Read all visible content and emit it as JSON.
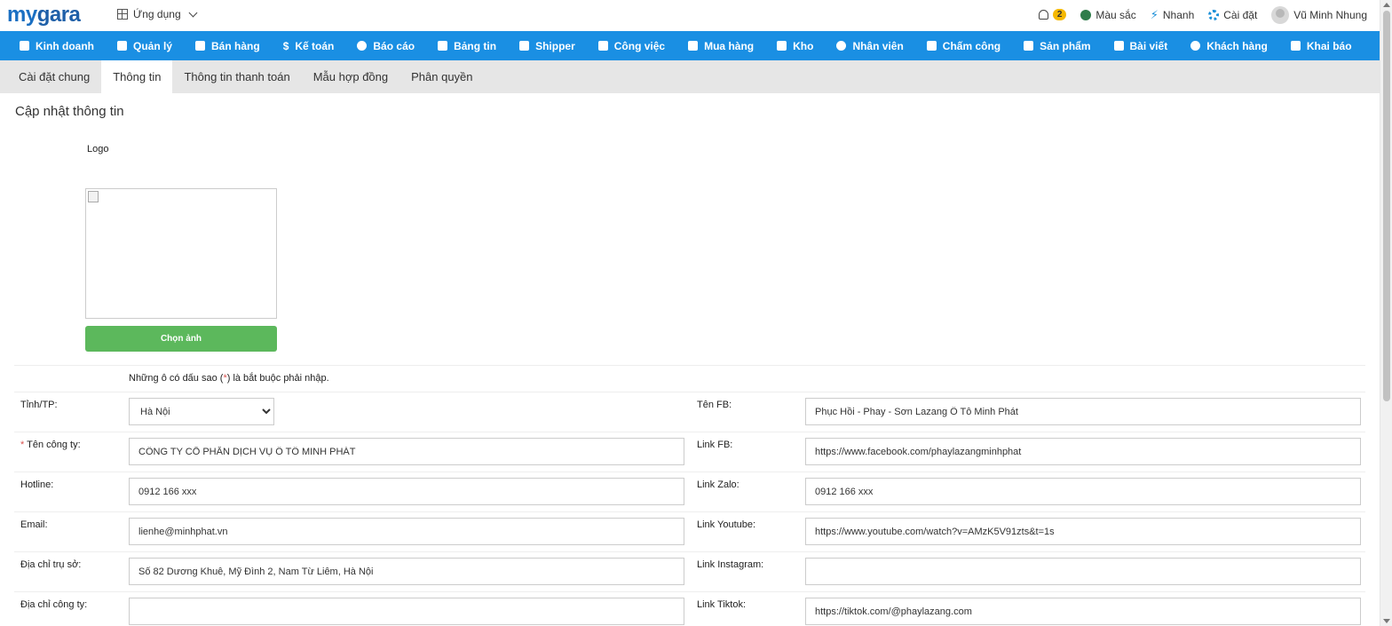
{
  "header": {
    "logo_part1": "my",
    "logo_part2": "gara",
    "apps_label": "Ứng dụng",
    "notification_count": "2",
    "color_label": "Màu sắc",
    "quick_label": "Nhanh",
    "settings_label": "Cài đặt",
    "user_name": "Vũ Minh Nhung"
  },
  "nav": {
    "items": [
      {
        "label": "Kinh doanh",
        "icon": "bag-icon"
      },
      {
        "label": "Quản lý",
        "icon": "id-card-icon"
      },
      {
        "label": "Bán hàng",
        "icon": "cart-icon"
      },
      {
        "label": "Kế toán",
        "icon": "dollar-icon"
      },
      {
        "label": "Báo cáo",
        "icon": "pie-chart-icon"
      },
      {
        "label": "Bảng tin",
        "icon": "home-icon"
      },
      {
        "label": "Shipper",
        "icon": "truck-icon"
      },
      {
        "label": "Công việc",
        "icon": "calendar-icon"
      },
      {
        "label": "Mua hàng",
        "icon": "basket-icon"
      },
      {
        "label": "Kho",
        "icon": "warehouse-icon"
      },
      {
        "label": "Nhân viên",
        "icon": "user-icon"
      },
      {
        "label": "Chấm công",
        "icon": "calendar-check-icon"
      },
      {
        "label": "Sản phẩm",
        "icon": "box-icon"
      },
      {
        "label": "Bài viết",
        "icon": "book-icon"
      },
      {
        "label": "Khách hàng",
        "icon": "smile-icon"
      },
      {
        "label": "Khai báo",
        "icon": "list-icon"
      }
    ]
  },
  "tabs": [
    {
      "label": "Cài đặt chung",
      "active": false
    },
    {
      "label": "Thông tin",
      "active": true
    },
    {
      "label": "Thông tin thanh toán",
      "active": false
    },
    {
      "label": "Mẫu hợp đồng",
      "active": false
    },
    {
      "label": "Phân quyền",
      "active": false
    }
  ],
  "page": {
    "title": "Cập nhật thông tin",
    "logo_label": "Logo",
    "choose_image_button": "Chọn ảnh",
    "required_note_before": "Những ô có dấu sao (",
    "required_star": "*",
    "required_note_after": ") là bắt buộc phải nhập."
  },
  "form": {
    "province_label": "Tỉnh/TP:",
    "province_value": "Hà Nội",
    "company_label": "Tên công ty:",
    "company_value": "CÔNG TY CỔ PHẦN DỊCH VỤ Ô TÔ MINH PHÁT",
    "hotline_label": "Hotline:",
    "hotline_value": "0912 166 xxx",
    "email_label": "Email:",
    "email_value": "lienhe@minhphat.vn",
    "hq_address_label": "Địa chỉ trụ sở:",
    "hq_address_value": "Số 82 Dương Khuê, Mỹ Đình 2, Nam Từ Liêm, Hà Nội",
    "company_address_label": "Địa chỉ công ty:",
    "company_address_value": "",
    "fb_name_label": "Tên FB:",
    "fb_name_value": "Phục Hồi - Phay - Sơn Lazang Ô Tô Minh Phát",
    "fb_link_label": "Link FB:",
    "fb_link_value": "https://www.facebook.com/phaylazangminhphat",
    "zalo_label": "Link Zalo:",
    "zalo_value": "0912 166 xxx",
    "youtube_label": "Link Youtube:",
    "youtube_value": "https://www.youtube.com/watch?v=AMzK5V91zts&t=1s",
    "instagram_label": "Link Instagram:",
    "instagram_value": "",
    "tiktok_label": "Link Tiktok:",
    "tiktok_value": "https://tiktok.com/@phaylazang.com"
  }
}
